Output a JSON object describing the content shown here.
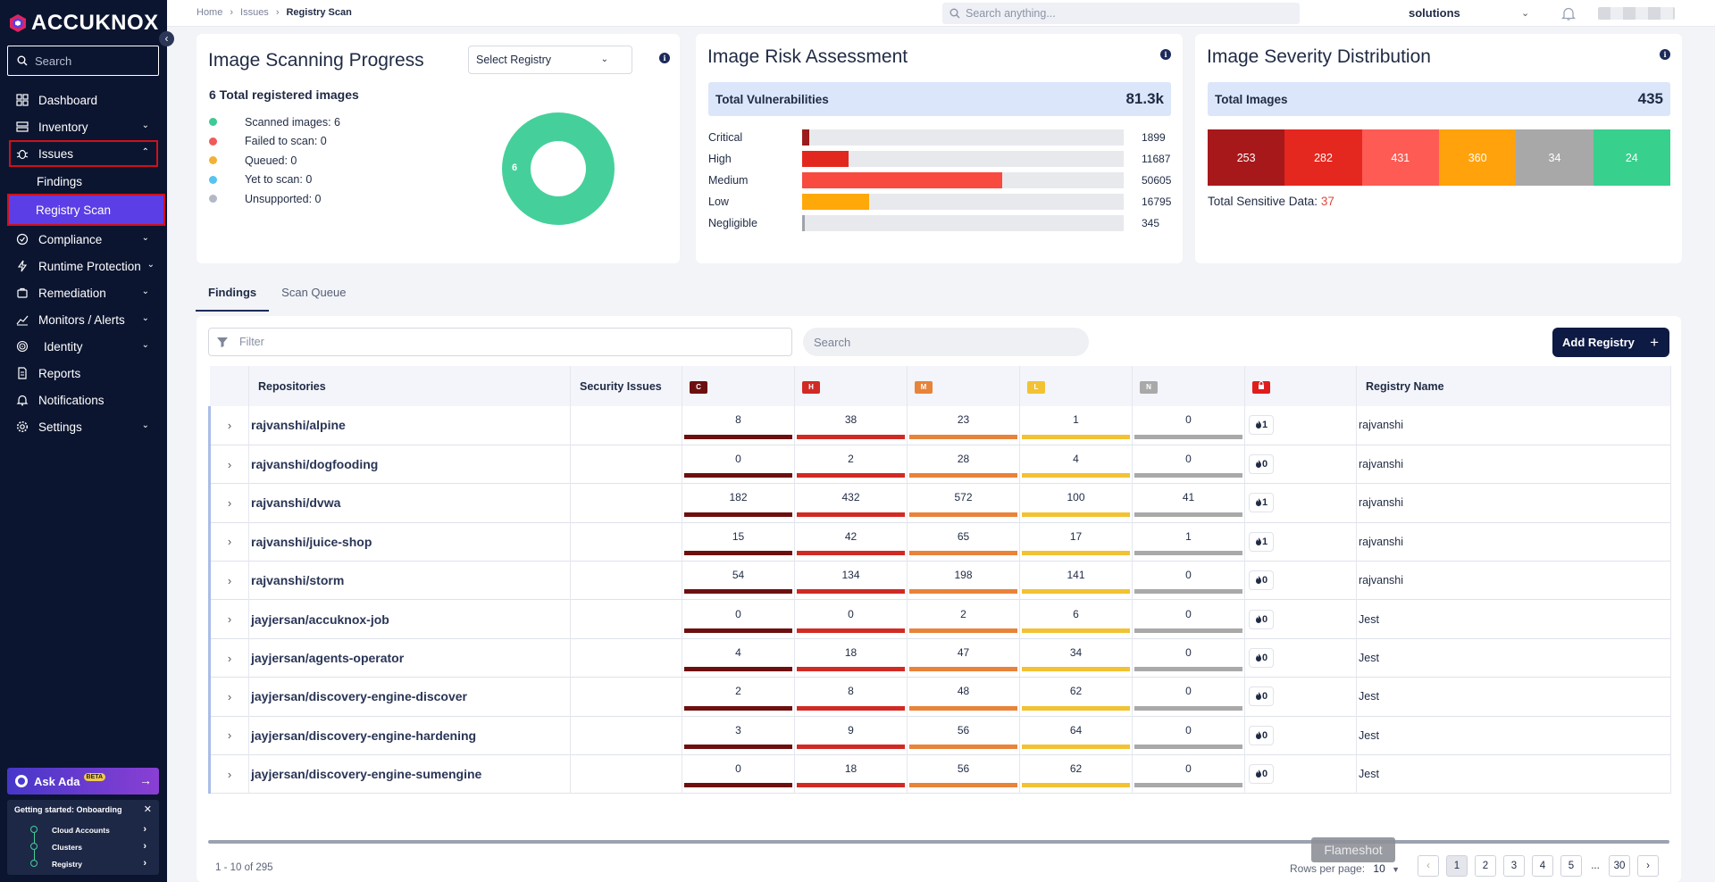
{
  "brand": {
    "name": "ACCUKNOX"
  },
  "sidebar": {
    "search_placeholder": "Search",
    "items": [
      {
        "label": "Dashboard"
      },
      {
        "label": "Inventory"
      },
      {
        "label": "Issues"
      },
      {
        "label": "Findings"
      },
      {
        "label": "Registry Scan"
      },
      {
        "label": "Compliance"
      },
      {
        "label": "Runtime Protection"
      },
      {
        "label": "Remediation"
      },
      {
        "label": "Monitors / Alerts"
      },
      {
        "label": "Identity"
      },
      {
        "label": "Reports"
      },
      {
        "label": "Notifications"
      },
      {
        "label": "Settings"
      }
    ],
    "ask_ada": "Ask Ada",
    "beta": "BETA",
    "onboarding": {
      "title": "Getting started: Onboarding",
      "steps": [
        "Cloud Accounts",
        "Clusters",
        "Registry"
      ]
    }
  },
  "topbar": {
    "breadcrumbs": [
      "Home",
      "Issues",
      "Registry Scan"
    ],
    "search_placeholder": "Search anything...",
    "tenant": "solutions"
  },
  "scan_progress": {
    "title": "Image Scanning Progress",
    "select_placeholder": "Select Registry",
    "total_label": "6 Total registered images",
    "legend": [
      {
        "label": "Scanned images: 6",
        "color": "#3ec995"
      },
      {
        "label": "Failed to scan: 0",
        "color": "#f05a57"
      },
      {
        "label": "Queued: 0",
        "color": "#f2b134"
      },
      {
        "label": "Yet to scan: 0",
        "color": "#56c3f0"
      },
      {
        "label": "Unsupported: 0",
        "color": "#b4b8c6"
      }
    ],
    "donut_value": "6"
  },
  "risk": {
    "title": "Image Risk Assessment",
    "total_label": "Total Vulnerabilities",
    "total_value": "81.3k",
    "rows": [
      {
        "label": "Critical",
        "value": "1899",
        "fraction": 0.023,
        "color": "#9b1c1c"
      },
      {
        "label": "High",
        "value": "11687",
        "fraction": 0.144,
        "color": "#e2281e"
      },
      {
        "label": "Medium",
        "value": "50605",
        "fraction": 0.622,
        "color": "#f84a3f"
      },
      {
        "label": "Low",
        "value": "16795",
        "fraction": 0.207,
        "color": "#ffa80a"
      },
      {
        "label": "Negligible",
        "value": "345",
        "fraction": 0.004,
        "color": "#9ea3ad"
      }
    ]
  },
  "severity": {
    "title": "Image Severity Distribution",
    "total_label": "Total Images",
    "total_value": "435",
    "cells": [
      {
        "value": "253",
        "color": "#a7181b"
      },
      {
        "value": "282",
        "color": "#e4271f"
      },
      {
        "value": "431",
        "color": "#fd5b54"
      },
      {
        "value": "360",
        "color": "#ffa20b"
      },
      {
        "value": "34",
        "color": "#a8a8a8"
      },
      {
        "value": "24",
        "color": "#38d08d"
      }
    ],
    "sensitive_label": "Total Sensitive Data:",
    "sensitive_value": "37"
  },
  "tabs": [
    "Findings",
    "Scan Queue"
  ],
  "toolbar": {
    "filter_placeholder": "Filter",
    "search_placeholder": "Search",
    "add_label": "Add Registry"
  },
  "table": {
    "headers": {
      "repositories": "Repositories",
      "security": "Security Issues",
      "registry": "Registry Name",
      "sev": [
        "C",
        "H",
        "M",
        "L",
        "N"
      ]
    },
    "sev_colors": [
      "#6e0f0f",
      "#d12a24",
      "#e8833a",
      "#f2c233",
      "#a9a9a9"
    ],
    "rows": [
      {
        "repo": "rajvanshi/alpine",
        "c": "8",
        "h": "38",
        "m": "23",
        "l": "1",
        "n": "0",
        "secrets": "1",
        "registry": "rajvanshi"
      },
      {
        "repo": "rajvanshi/dogfooding",
        "c": "0",
        "h": "2",
        "m": "28",
        "l": "4",
        "n": "0",
        "secrets": "0",
        "registry": "rajvanshi"
      },
      {
        "repo": "rajvanshi/dvwa",
        "c": "182",
        "h": "432",
        "m": "572",
        "l": "100",
        "n": "41",
        "secrets": "1",
        "registry": "rajvanshi"
      },
      {
        "repo": "rajvanshi/juice-shop",
        "c": "15",
        "h": "42",
        "m": "65",
        "l": "17",
        "n": "1",
        "secrets": "1",
        "registry": "rajvanshi"
      },
      {
        "repo": "rajvanshi/storm",
        "c": "54",
        "h": "134",
        "m": "198",
        "l": "141",
        "n": "0",
        "secrets": "0",
        "registry": "rajvanshi"
      },
      {
        "repo": "jayjersan/accuknox-job",
        "c": "0",
        "h": "0",
        "m": "2",
        "l": "6",
        "n": "0",
        "secrets": "0",
        "registry": "Jest"
      },
      {
        "repo": "jayjersan/agents-operator",
        "c": "4",
        "h": "18",
        "m": "47",
        "l": "34",
        "n": "0",
        "secrets": "0",
        "registry": "Jest"
      },
      {
        "repo": "jayjersan/discovery-engine-discover",
        "c": "2",
        "h": "8",
        "m": "48",
        "l": "62",
        "n": "0",
        "secrets": "0",
        "registry": "Jest"
      },
      {
        "repo": "jayjersan/discovery-engine-hardening",
        "c": "3",
        "h": "9",
        "m": "56",
        "l": "64",
        "n": "0",
        "secrets": "0",
        "registry": "Jest"
      },
      {
        "repo": "jayjersan/discovery-engine-sumengine",
        "c": "0",
        "h": "18",
        "m": "56",
        "l": "62",
        "n": "0",
        "secrets": "0",
        "registry": "Jest"
      }
    ]
  },
  "pagination": {
    "range": "1 - 10 of 295",
    "rows_label": "Rows per page:",
    "rows_value": "10",
    "pages": [
      "1",
      "2",
      "3",
      "4",
      "5",
      "...",
      "30"
    ]
  },
  "overlay": {
    "flameshot": "Flameshot"
  }
}
